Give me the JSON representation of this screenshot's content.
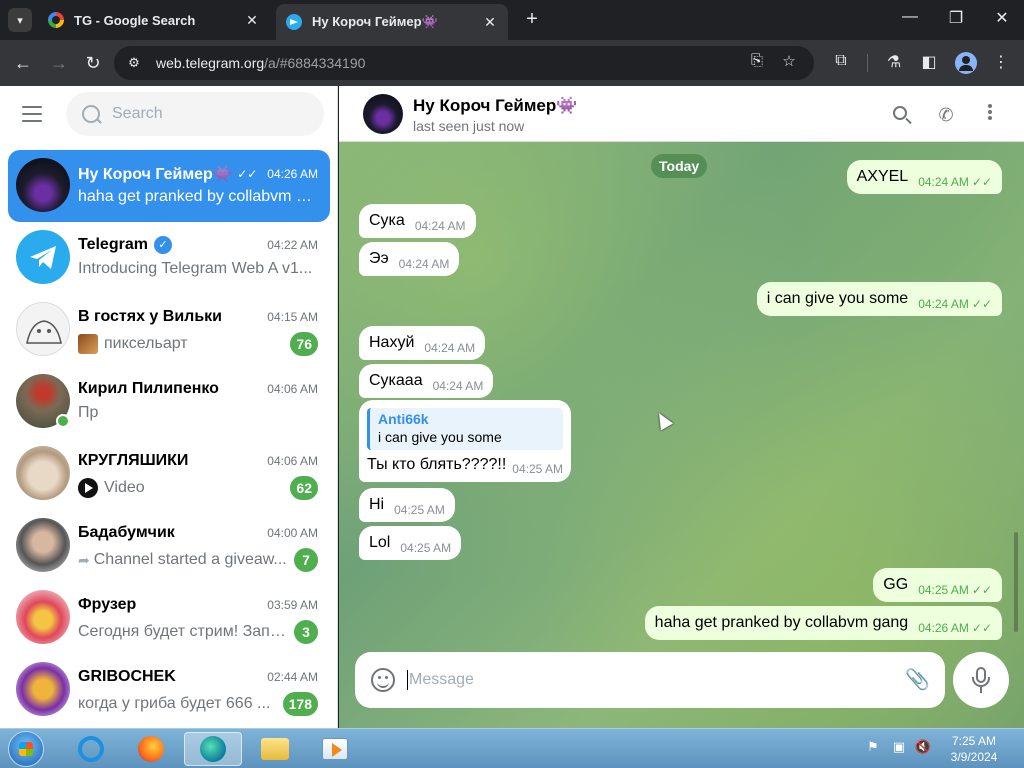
{
  "browser": {
    "tabs": [
      {
        "title": "TG - Google Search"
      },
      {
        "title": "Ну Короч Геймер👾"
      }
    ],
    "url_host": "web.telegram.org",
    "url_path": "/a/#6884334190"
  },
  "sidebar": {
    "search_placeholder": "Search",
    "chats": [
      {
        "name": "Ну Короч Геймер👾",
        "time": "04:26 AM",
        "preview": "haha get pranked by collabvm g...",
        "active": true,
        "read": "✓✓"
      },
      {
        "name": "Telegram",
        "time": "04:22 AM",
        "preview": "Introducing Telegram Web A v1...",
        "verified": true
      },
      {
        "name": "В гостях у Вильки",
        "time": "04:15 AM",
        "preview": "пиксельарт",
        "badge": "76"
      },
      {
        "name": "Кирил Пилипенко",
        "time": "04:06 AM",
        "preview": "Пр",
        "online": true
      },
      {
        "name": "КРУГЛЯШИКИ",
        "time": "04:06 AM",
        "preview": "Video",
        "badge": "62"
      },
      {
        "name": "Бадабумчик",
        "time": "04:00 AM",
        "preview": "Channel started a giveaw...",
        "badge": "7"
      },
      {
        "name": "Фрузер",
        "time": "03:59 AM",
        "preview": "Сегодня будет стрим! Запу...",
        "badge": "3"
      },
      {
        "name": "GRIBOCHEK",
        "time": "02:44 AM",
        "preview": "когда у гриба будет 666 ...",
        "badge": "178"
      }
    ]
  },
  "chat": {
    "title": "Ну Короч Геймер👾",
    "status": "last seen just now",
    "date_label": "Today",
    "messages": [
      {
        "text": "AXYEL",
        "time": "04:24 AM",
        "out": true
      },
      {
        "text": "Сука",
        "time": "04:24 AM",
        "out": false
      },
      {
        "text": "Ээ",
        "time": "04:24 AM",
        "out": false
      },
      {
        "text": "i can give you some",
        "time": "04:24 AM",
        "out": true
      },
      {
        "text": "Нахуй",
        "time": "04:24 AM",
        "out": false
      },
      {
        "text": "Сукааа",
        "time": "04:24 AM",
        "out": false
      },
      {
        "text": "Ты кто блять????!!",
        "time": "04:25 AM",
        "out": false,
        "reply_name": "Anti66k",
        "reply_text": "i can give you some"
      },
      {
        "text": "Hi",
        "time": "04:25 AM",
        "out": false
      },
      {
        "text": "Lol",
        "time": "04:25 AM",
        "out": false
      },
      {
        "text": "GG",
        "time": "04:25 AM",
        "out": true
      },
      {
        "text": "haha get pranked by collabvm gang",
        "time": "04:26 AM",
        "out": true
      }
    ],
    "composer_placeholder": "Message"
  },
  "taskbar": {
    "time": "7:25 AM",
    "date": "3/9/2024"
  },
  "colors": {
    "accent": "#3390ec",
    "unread_badge": "#4fae4e",
    "outgoing_bubble": "#eeffde"
  }
}
